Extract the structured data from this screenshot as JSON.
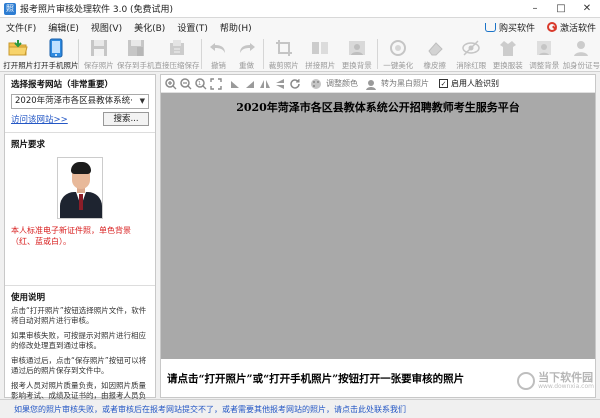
{
  "window": {
    "title": "报考照片审核处理软件 3.0 (免费试用)",
    "controls": [
      "minimize",
      "maximize",
      "close"
    ]
  },
  "menu": {
    "items": [
      "文件(F)",
      "编辑(E)",
      "视图(V)",
      "美化(B)",
      "设置(T)",
      "帮助(H)"
    ],
    "buy": "购买软件",
    "activate": "激活软件"
  },
  "toolbar": {
    "items": [
      {
        "label": "打开照片",
        "icon": "open-folder-icon",
        "enabled": true
      },
      {
        "label": "打开手机照片",
        "icon": "phone-icon",
        "enabled": true
      },
      {
        "label": "保存照片",
        "icon": "save-icon",
        "enabled": false
      },
      {
        "label": "保存到手机",
        "icon": "save-to-phone-icon",
        "enabled": false
      },
      {
        "label": "直接压缩保存",
        "icon": "compress-save-icon",
        "enabled": false
      },
      {
        "label": "撤销",
        "icon": "undo-icon",
        "enabled": false
      },
      {
        "label": "重做",
        "icon": "redo-icon",
        "enabled": false
      },
      {
        "label": "裁剪照片",
        "icon": "crop-icon",
        "enabled": false
      },
      {
        "label": "拼接照片",
        "icon": "stitch-icon",
        "enabled": false
      },
      {
        "label": "更换背景",
        "icon": "background-icon",
        "enabled": false
      },
      {
        "label": "一键美化",
        "icon": "beautify-icon",
        "enabled": false
      },
      {
        "label": "橡皮擦",
        "icon": "eraser-icon",
        "enabled": false
      },
      {
        "label": "消除红眼",
        "icon": "red-eye-icon",
        "enabled": false
      },
      {
        "label": "更换服装",
        "icon": "clothes-icon",
        "enabled": false
      },
      {
        "label": "调整背景",
        "icon": "adjust-background-icon",
        "enabled": false
      },
      {
        "label": "加身份证号",
        "icon": "id-number-icon",
        "enabled": false
      }
    ]
  },
  "left_panel": {
    "select_site_title": "选择报考网站（非常重要）",
    "selected_site": "2020年菏泽市各区县教体系统·",
    "visit_link": "访问该网站>>",
    "search_button": "搜索...",
    "photo_req_title": "照片要求",
    "photo_req_note": "本人标准电子新证件照，单色背景（红、蓝或白）。",
    "usage_title": "使用说明",
    "usage_paragraphs": [
      "点击“打开照片”按钮选择照片文件，软件将自动对照片进行审核。",
      "如果审核失败，可按提示对照片进行相应的修改处理直到通过审核。",
      "审核通过后，点击“保存照片”按钮可以将通过后的照片保存到文件中。",
      "报考人员对照片质量负责，如因照片质量影响考试、成绩及证书的，由报考人员负责。"
    ]
  },
  "preview": {
    "toolbar": {
      "zoom_icons": [
        "zoom-in-icon",
        "zoom-out-icon",
        "actual-size-icon",
        "fit-window-icon"
      ],
      "transform_icons": [
        "rotate-left-icon",
        "rotate-right-icon",
        "flip-horizontal-icon",
        "flip-vertical-icon",
        "refresh-icon"
      ],
      "adjust_color": "调整颜色",
      "to_grayscale": "转为黑白照片",
      "face_detect_label": "启用人脸识别",
      "face_detect_checked": true
    },
    "heading": "2020年菏泽市各区县教体系统公开招聘教师考生服务平台",
    "prompt": "请点击“打开照片”或“打开手机照片”按钮打开一张要审核的照片"
  },
  "status": {
    "text": "如果您的照片审核失败，或者审核后在报考网站提交不了，或者需要其他报考网站的照片，请点击此处联系我们"
  },
  "watermark": {
    "text": "当下软件园",
    "sub": "www.downxia.com"
  },
  "colors": {
    "accent_blue": "#2457c5",
    "warning_red": "#d81e1e",
    "canvas_gray": "#a9a9a9"
  }
}
